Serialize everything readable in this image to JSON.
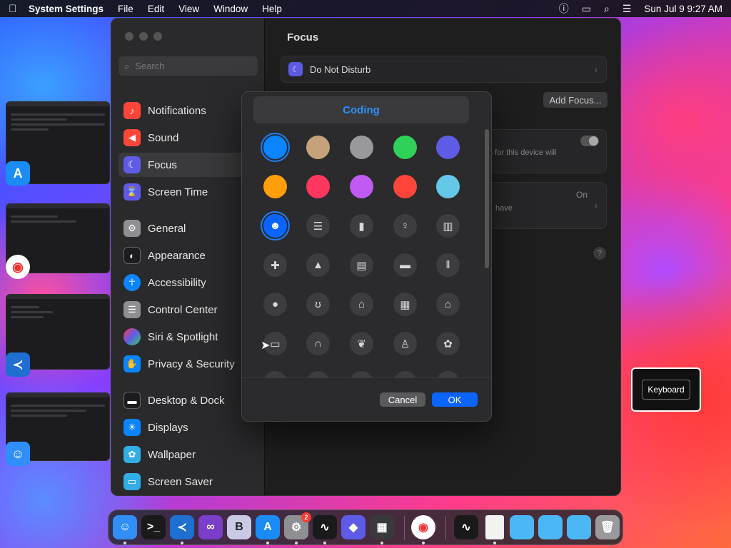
{
  "menubar": {
    "app_name": "System Settings",
    "menus": [
      "File",
      "Edit",
      "View",
      "Window",
      "Help"
    ],
    "datetime": "Sun Jul 9  9:27 AM"
  },
  "sidebar": {
    "search_placeholder": "Search",
    "items": [
      {
        "label": "Notifications",
        "icon": "bell-icon",
        "color": "#ff453a"
      },
      {
        "label": "Sound",
        "icon": "speaker-icon",
        "color": "#ff453a"
      },
      {
        "label": "Focus",
        "icon": "moon-icon",
        "color": "#5e5ce6"
      },
      {
        "label": "Screen Time",
        "icon": "hourglass-icon",
        "color": "#5e5ce6"
      },
      {
        "label": "General",
        "icon": "gear-icon",
        "color": "#8e8e93"
      },
      {
        "label": "Appearance",
        "icon": "appearance-icon",
        "color": "#1c1c1e"
      },
      {
        "label": "Accessibility",
        "icon": "accessibility-icon",
        "color": "#0a84ff"
      },
      {
        "label": "Control Center",
        "icon": "control-center-icon",
        "color": "#8e8e93"
      },
      {
        "label": "Siri & Spotlight",
        "icon": "siri-icon",
        "color": "#bf5af2"
      },
      {
        "label": "Privacy & Security",
        "icon": "hand-icon",
        "color": "#0a84ff"
      },
      {
        "label": "Desktop & Dock",
        "icon": "dock-icon",
        "color": "#1c1c1e"
      },
      {
        "label": "Displays",
        "icon": "sun-icon",
        "color": "#0a84ff"
      },
      {
        "label": "Wallpaper",
        "icon": "wallpaper-icon",
        "color": "#32ade6"
      },
      {
        "label": "Screen Saver",
        "icon": "screensaver-icon",
        "color": "#32ade6"
      }
    ]
  },
  "content": {
    "title": "Focus",
    "dnd_label": "Do Not Disturb",
    "add_focus_label": "Add Focus...",
    "partial_text_1": "n for this device will",
    "partial_text_2": "On",
    "partial_text_3": "have",
    "help_label": "?"
  },
  "dialog": {
    "focus_name": "Coding",
    "cancel_label": "Cancel",
    "ok_label": "OK",
    "colors": [
      "#0a84ff",
      "#c6a27a",
      "#98989d",
      "#30d158",
      "#5e5ce6",
      "#ff9f0a",
      "#ff375f",
      "#bf5af2",
      "#ff453a",
      "#64c8e8"
    ],
    "glyphs": [
      {
        "name": "smiley-icon",
        "char": "☻"
      },
      {
        "name": "list-icon",
        "char": "☰"
      },
      {
        "name": "bookmark-icon",
        "char": "▮"
      },
      {
        "name": "pin-icon",
        "char": "♀"
      },
      {
        "name": "books-icon",
        "char": "▥"
      },
      {
        "name": "gift-icon",
        "char": "✚"
      },
      {
        "name": "graduation-cap-icon",
        "char": "▲"
      },
      {
        "name": "document-icon",
        "char": "▤"
      },
      {
        "name": "credit-card-icon",
        "char": "▬"
      },
      {
        "name": "fork-knife-icon",
        "char": "ǁ"
      },
      {
        "name": "pills-icon",
        "char": "●"
      },
      {
        "name": "stethoscope-icon",
        "char": "ʊ"
      },
      {
        "name": "house-icon",
        "char": "⌂"
      },
      {
        "name": "building-icon",
        "char": "▦"
      },
      {
        "name": "bank-icon",
        "char": "⌂"
      },
      {
        "name": "laptop-icon",
        "char": "▭"
      },
      {
        "name": "headphones-icon",
        "char": "∩"
      },
      {
        "name": "leaf-icon",
        "char": "❦"
      },
      {
        "name": "person-icon",
        "char": "♙"
      },
      {
        "name": "paw-icon",
        "char": "✿"
      }
    ]
  },
  "hud": {
    "label": "Keyboard"
  },
  "dock": {
    "settings_badge": "2",
    "items": [
      {
        "name": "finder-icon",
        "color": "#2f8ef7",
        "char": "☺"
      },
      {
        "name": "terminal-icon",
        "color": "#1a1a1a",
        "char": ">_"
      },
      {
        "name": "vscode-icon",
        "color": "#1e6fd0",
        "char": "≺"
      },
      {
        "name": "visual-studio-icon",
        "color": "#7a3ec9",
        "char": "∞"
      },
      {
        "name": "bbedit-icon",
        "color": "#c9cbe6",
        "char": "B"
      },
      {
        "name": "app-store-icon",
        "color": "#1b8cf5",
        "char": "A"
      },
      {
        "name": "system-settings-icon",
        "color": "#8e8e93",
        "char": "⚙"
      },
      {
        "name": "activity-monitor-icon",
        "color": "#1a1a1a",
        "char": "∿"
      },
      {
        "name": "shortcuts-icon",
        "color": "#5e5ce6",
        "char": "◆"
      },
      {
        "name": "launchpad-icon",
        "color": "#3a3a3c",
        "char": "▦"
      },
      {
        "name": "chrome-icon",
        "color": "#ffffff",
        "char": "◉"
      },
      {
        "name": "activity-monitor-recent-icon",
        "color": "#1a1a1a",
        "char": "∿"
      },
      {
        "name": "text-file-icon",
        "color": "#f2f2f2",
        "char": ""
      },
      {
        "name": "folder-icon",
        "color": "#4bb8f5",
        "char": ""
      },
      {
        "name": "folder-documents-icon",
        "color": "#4bb8f5",
        "char": ""
      },
      {
        "name": "folder-downloads-icon",
        "color": "#4bb8f5",
        "char": ""
      },
      {
        "name": "trash-icon",
        "color": "#9a9a9e",
        "char": "🗑"
      }
    ]
  }
}
